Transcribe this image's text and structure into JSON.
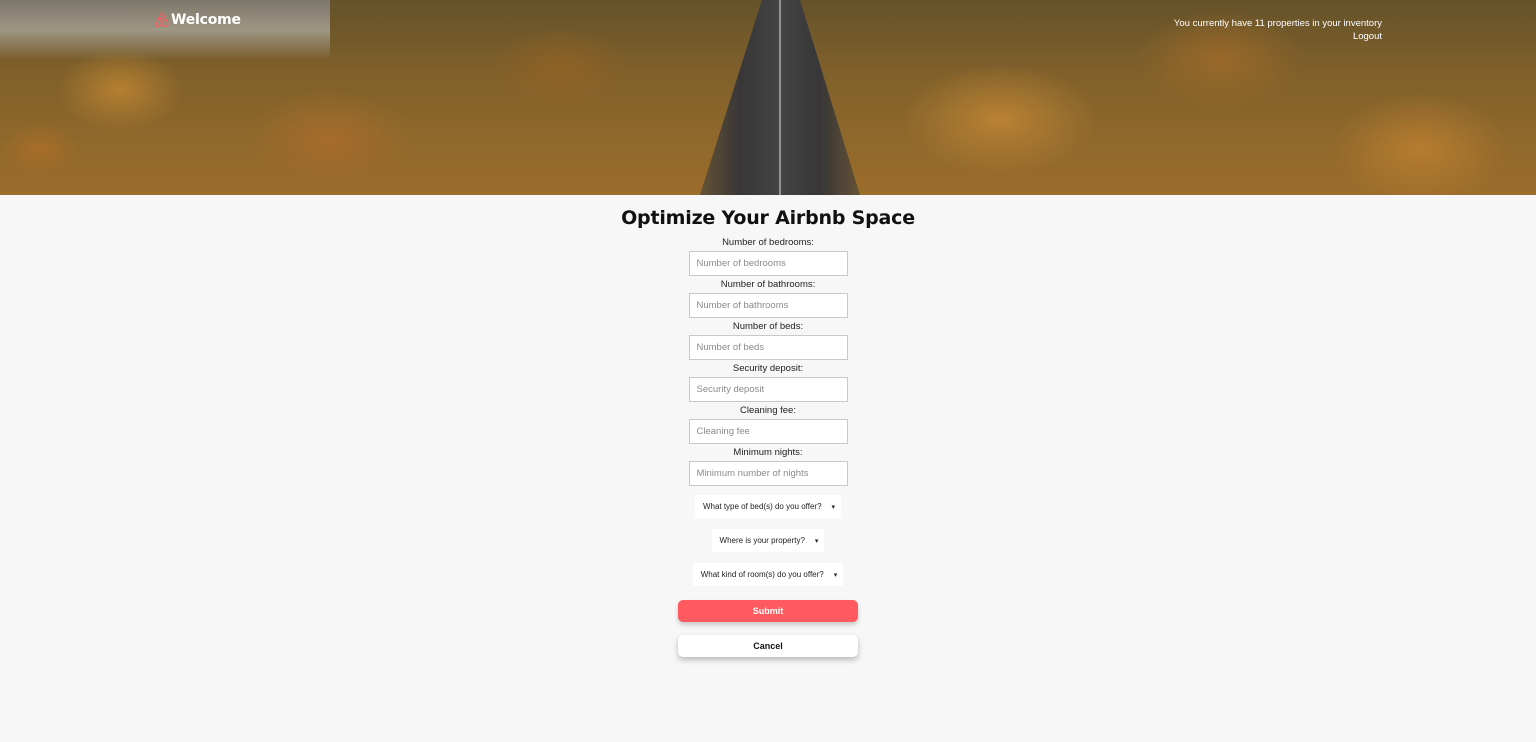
{
  "header": {
    "brand_title": "Welcome",
    "inventory_text": "You currently have 11 properties in your inventory",
    "logout_label": "Logout",
    "logo_icon": "airbnb-logo-icon",
    "logo_color": "#ff5a5f"
  },
  "main": {
    "title": "Optimize Your Airbnb Space"
  },
  "form": {
    "fields": [
      {
        "label": "Number of bedrooms:",
        "placeholder": "Number of bedrooms",
        "value": ""
      },
      {
        "label": "Number of bathrooms:",
        "placeholder": "Number of bathrooms",
        "value": ""
      },
      {
        "label": "Number of beds:",
        "placeholder": "Number of beds",
        "value": ""
      },
      {
        "label": "Security deposit:",
        "placeholder": "Security deposit",
        "value": ""
      },
      {
        "label": "Cleaning fee:",
        "placeholder": "Cleaning fee",
        "value": ""
      },
      {
        "label": "Minimum nights:",
        "placeholder": "Minimum number of nights",
        "value": ""
      }
    ],
    "selects": [
      {
        "selected": "What type of bed(s) do you offer?",
        "caret": "▾"
      },
      {
        "selected": "Where is your property?",
        "caret": "▾"
      },
      {
        "selected": "What kind of room(s) do you offer?",
        "caret": "▾"
      }
    ],
    "submit_label": "Submit",
    "cancel_label": "Cancel",
    "accent_color": "#ff5a5f"
  }
}
